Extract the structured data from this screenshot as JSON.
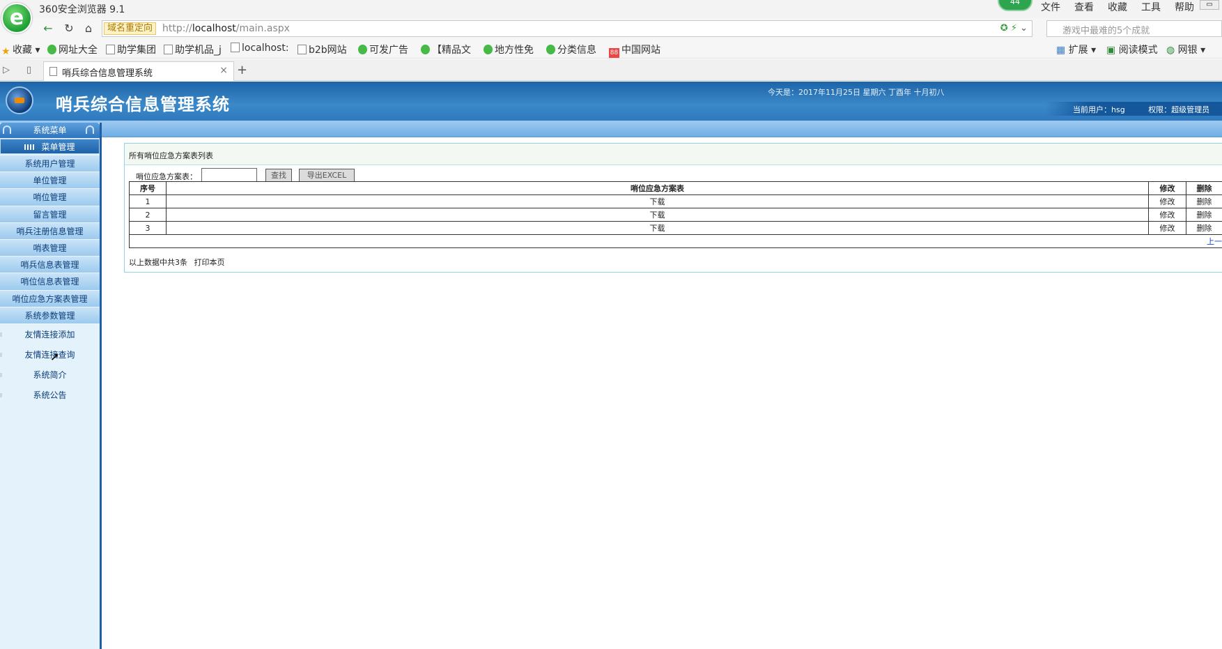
{
  "browser": {
    "title": "360安全浏览器 9.1",
    "logo_letter": "e",
    "badge": "44",
    "menu": [
      "文件",
      "查看",
      "收藏",
      "工具",
      "帮助"
    ],
    "redirect_tag": "域名重定向",
    "url_prefix": "http://",
    "url_host": "localhost",
    "url_path": "/main.aspx",
    "search_placeholder": "游戏中最难的5个成就",
    "bookmarks": [
      "收藏",
      "网址大全",
      "助学集团",
      "助学机品_j",
      "localhost:",
      "b2b网站",
      "可发广告",
      "【精品文",
      "地方性免",
      "分类信息",
      "中国网站"
    ],
    "bookmarks_right": [
      "扩展",
      "阅读模式",
      "网银"
    ],
    "tab_label": "哨兵综合信息管理系统",
    "tab_close": "×",
    "new_tab": "+"
  },
  "app": {
    "title": "哨兵综合信息管理系统",
    "date": "今天是：2017年11月25日 星期六 丁酉年 十月初八",
    "current_user": "当前用户：hsg",
    "permission": "权限：超级管理员"
  },
  "sidebar": {
    "header": "系统菜单",
    "section": "菜单管理",
    "items": [
      "系统用户管理",
      "单位管理",
      "哨位管理",
      "留言管理",
      "哨兵注册信息管理",
      "哨表管理",
      "哨兵信息表管理",
      "哨位信息表管理",
      "哨位应急方案表管理",
      "系统参数管理"
    ],
    "links": [
      "友情连接添加",
      "友情连接查询",
      "系统简介",
      "系统公告"
    ]
  },
  "main": {
    "panel_title": "所有哨位应急方案表列表",
    "search_label": "哨位应急方案表：",
    "search_value": "",
    "search_button": "查找",
    "export_button": "导出EXCEL",
    "table": {
      "headers": [
        "序号",
        "哨位应急方案表",
        "修改",
        "删除"
      ],
      "rows": [
        [
          "1",
          "下载",
          "修改",
          "删除"
        ],
        [
          "2",
          "下载",
          "修改",
          "删除"
        ],
        [
          "3",
          "下载",
          "修改",
          "删除"
        ]
      ],
      "pager": "上一"
    },
    "summary": "以上数据中共3条",
    "print_link": "打印本页"
  }
}
